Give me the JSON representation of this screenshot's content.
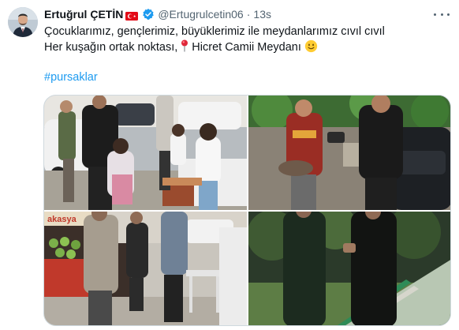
{
  "tweet": {
    "author_name": "Ertuğrul ÇETİN",
    "handle": "@Ertugrulcetin06",
    "separator": "·",
    "time": "13s",
    "line1": "Çocuklarımız, gençlerimiz, büyüklerimiz ile meydanlarımız cıvıl cıvıl",
    "line2_before_pin": "Her kuşağın ortak noktası, ",
    "line2_after_pin": " Hicret Camii Meydanı ",
    "hashtag": "#pursaklar"
  },
  "photo3": {
    "sign_text": "akasya"
  },
  "icons": {
    "flag": "turkey-flag-icon",
    "verified": "verified-badge-icon",
    "more": "more-options-icon",
    "pin": "round-pushpin-icon",
    "smile": "slightly-smiling-face-icon"
  },
  "colors": {
    "link": "#1d9bf0",
    "secondary_text": "#536471",
    "verified": "#1d9bf0",
    "flag_red": "#e30a17"
  }
}
